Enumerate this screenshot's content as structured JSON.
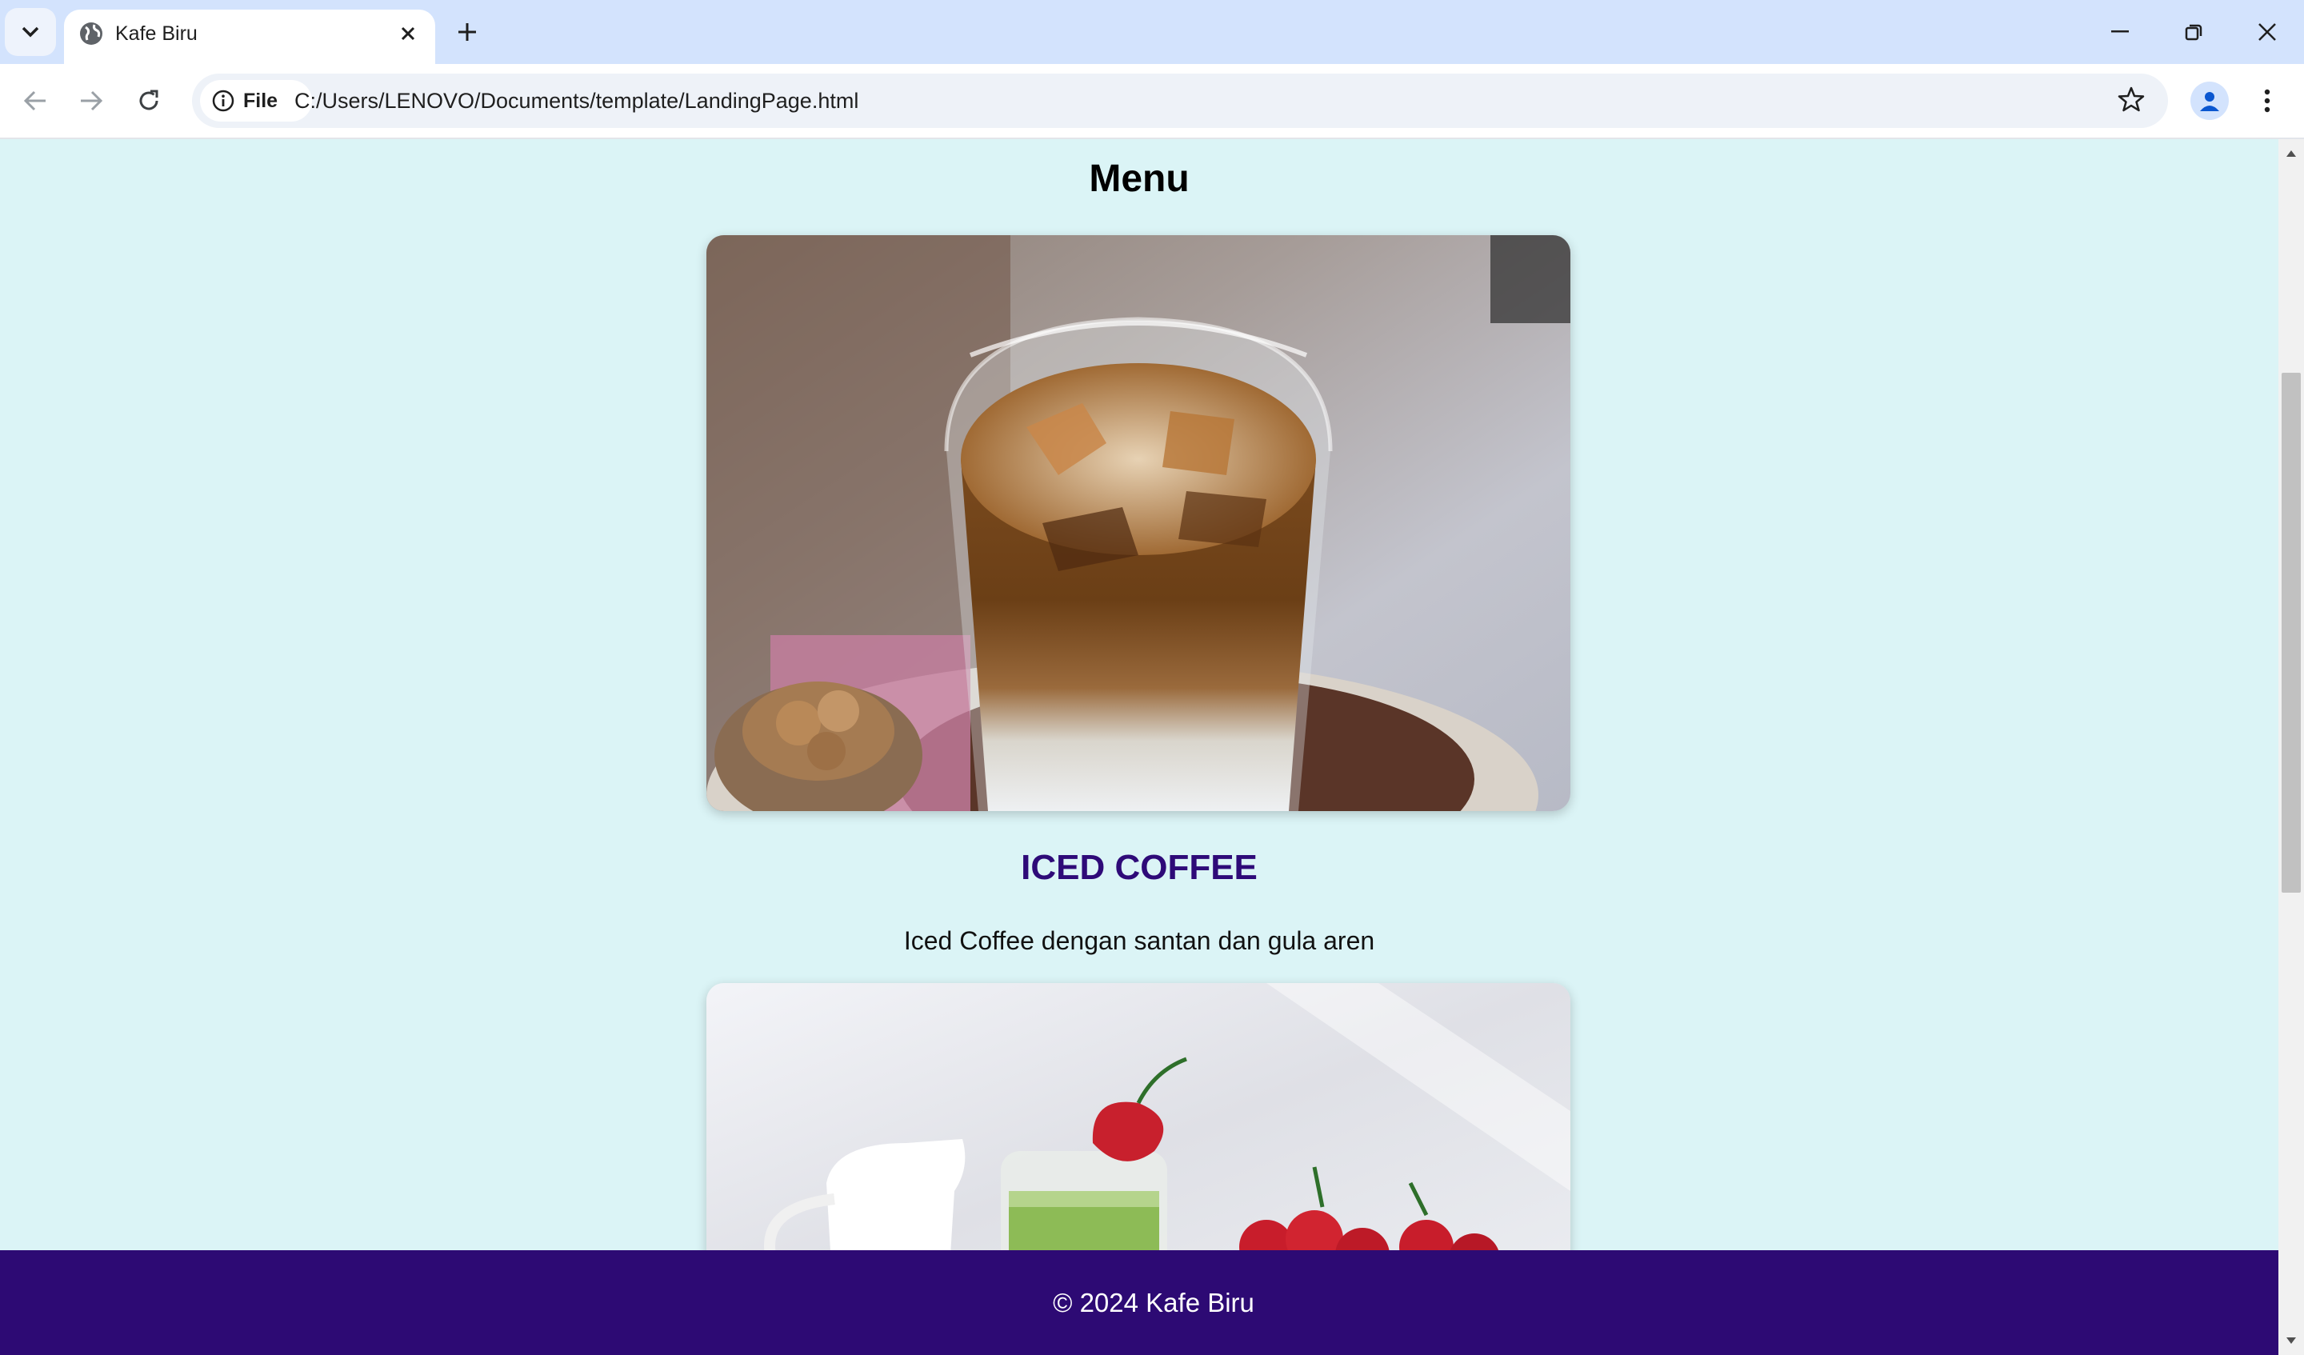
{
  "browser": {
    "tab": {
      "title": "Kafe Biru"
    },
    "address": {
      "chip_label": "File",
      "url": "C:/Users/LENOVO/Documents/template/LandingPage.html"
    }
  },
  "page": {
    "menu_heading": "Menu",
    "items": [
      {
        "title": "ICED COFFEE",
        "description": "Iced Coffee dengan santan dan gula aren",
        "image": "iced-coffee-photo"
      },
      {
        "image": "matcha-strawberry-photo"
      }
    ],
    "footer": "© 2024 Kafe Biru"
  },
  "colors": {
    "page_bg": "#dbf4f6",
    "footer_bg": "#2d0a74",
    "item_title": "#2e0a78",
    "tabbar_bg": "#d3e3fd"
  }
}
